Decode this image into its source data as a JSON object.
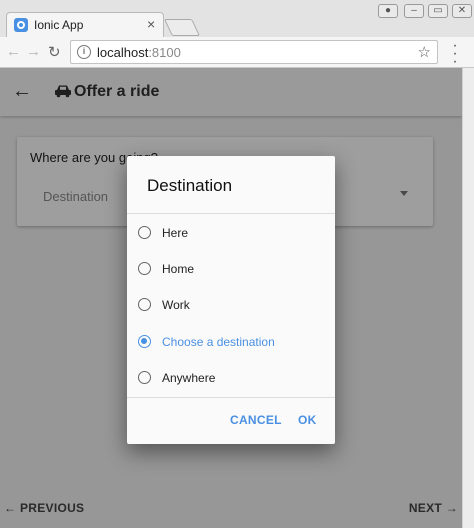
{
  "browser": {
    "tab_title": "Ionic App",
    "tab_close": "×",
    "url_host": "localhost",
    "url_port": ":8100",
    "window_buttons": [
      "●",
      "–",
      "▭",
      "✕"
    ]
  },
  "app": {
    "title": "Offer a ride",
    "card_label": "Where are you going?",
    "select_placeholder": "Destination",
    "footer": {
      "previous": "PREVIOUS",
      "next": "NEXT"
    }
  },
  "dialog": {
    "title": "Destination",
    "options": [
      {
        "label": "Here",
        "checked": false
      },
      {
        "label": "Home",
        "checked": false
      },
      {
        "label": "Work",
        "checked": false
      },
      {
        "label": "Choose a destination",
        "checked": true
      },
      {
        "label": "Anywhere",
        "checked": false
      }
    ],
    "cancel": "CANCEL",
    "ok": "OK"
  },
  "colors": {
    "accent": "#4a90e2",
    "backdrop": "#000000"
  }
}
